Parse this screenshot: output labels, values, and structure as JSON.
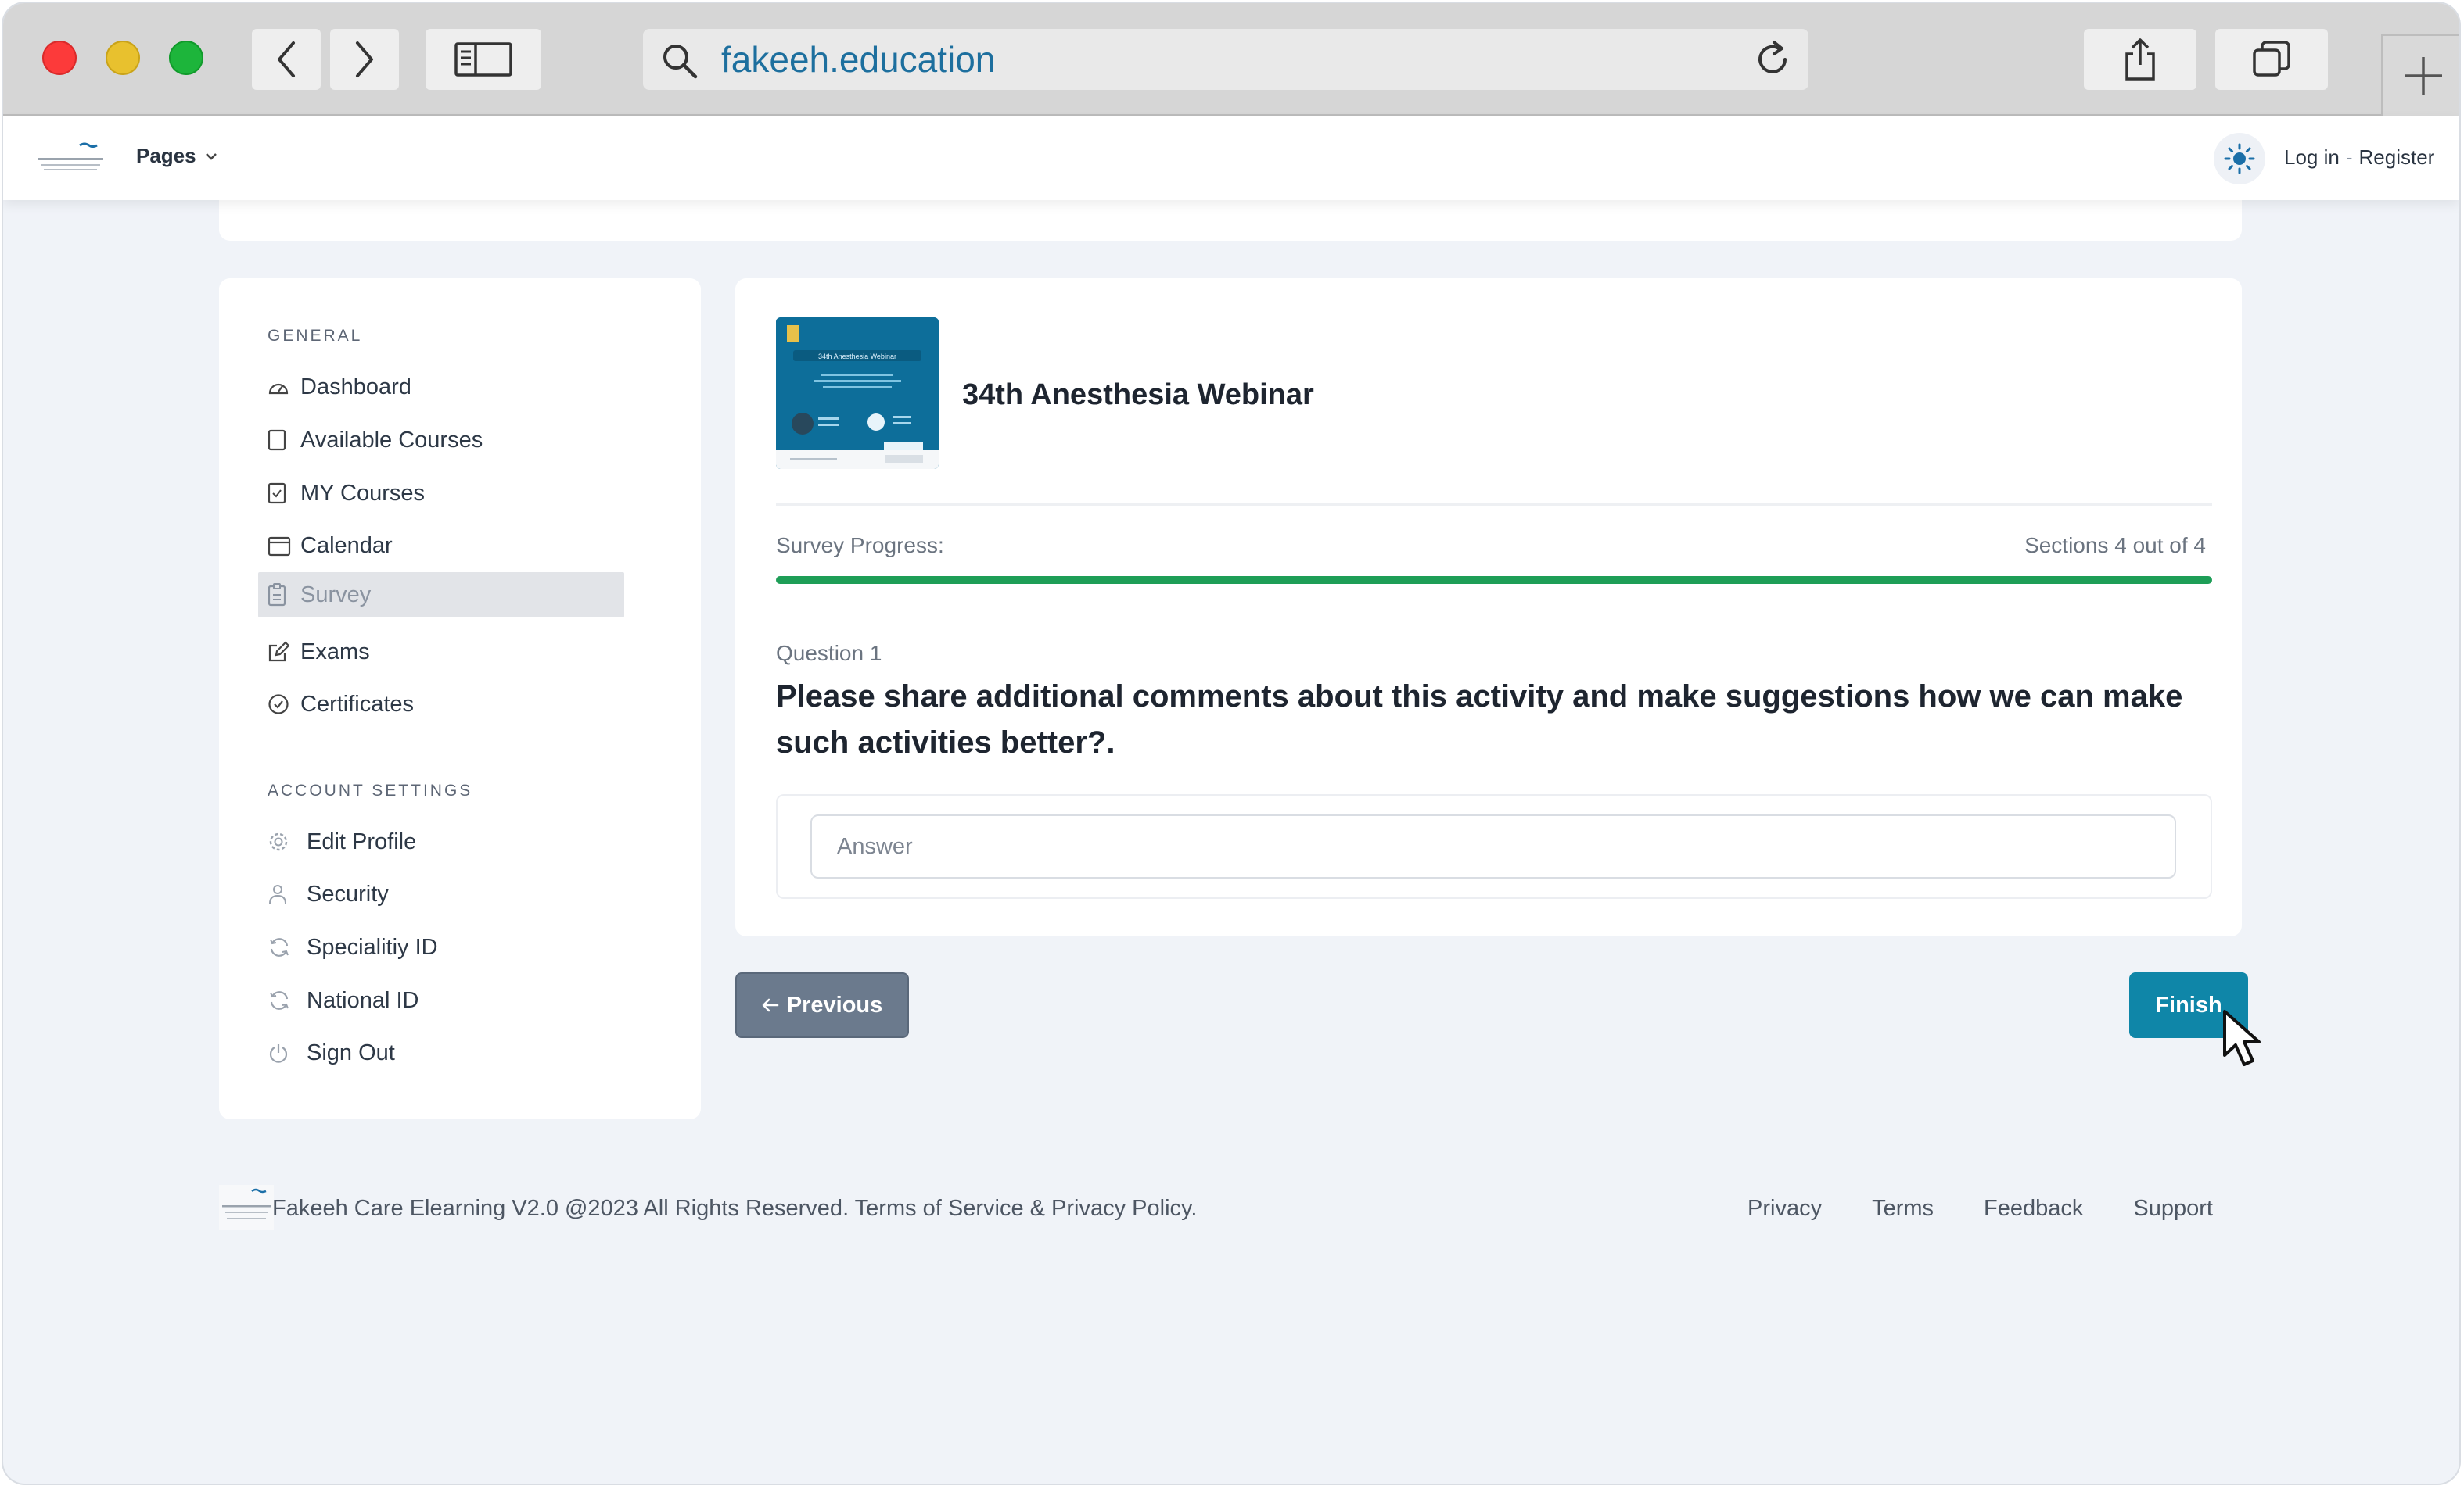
{
  "browser": {
    "url": "fakeeh.education"
  },
  "header": {
    "pages_label": "Pages",
    "login_label": "Log in",
    "separator": "-",
    "register_label": "Register"
  },
  "sidebar": {
    "general_heading": "GENERAL",
    "general_items": [
      {
        "label": "Dashboard",
        "icon": "dashboard-icon"
      },
      {
        "label": "Available Courses",
        "icon": "square-icon"
      },
      {
        "label": "MY Courses",
        "icon": "checkbox-icon"
      },
      {
        "label": "Calendar",
        "icon": "calendar-icon"
      },
      {
        "label": "Survey",
        "icon": "clipboard-icon",
        "active": true
      },
      {
        "label": "Exams",
        "icon": "edit-icon"
      },
      {
        "label": "Certificates",
        "icon": "check-circle-icon"
      }
    ],
    "account_heading": "ACCOUNT SETTINGS",
    "account_items": [
      {
        "label": "Edit Profile",
        "icon": "gear-icon"
      },
      {
        "label": "Security",
        "icon": "user-icon"
      },
      {
        "label": "Specialitiy ID",
        "icon": "refresh-icon"
      },
      {
        "label": "National ID",
        "icon": "refresh-icon"
      },
      {
        "label": "Sign Out",
        "icon": "power-icon"
      }
    ]
  },
  "course": {
    "title": "34th Anesthesia Webinar",
    "thumbnail_title": "34th Anesthesia Webinar"
  },
  "survey": {
    "progress_label": "Survey Progress:",
    "progress_count": "Sections 4 out of 4",
    "progress_fraction": 1.0,
    "question_number": "Question 1",
    "question_text": "Please share additional comments about this activity and make suggestions how we can make such activities better?.",
    "answer_placeholder": "Answer",
    "answer_value": ""
  },
  "actions": {
    "previous_label": "Previous",
    "finish_label": "Finish"
  },
  "footer": {
    "copyright": "Fakeeh Care Elearning V2.0 @2023 All Rights Reserved. Terms of Service & Privacy Policy.",
    "links": [
      "Privacy",
      "Terms",
      "Feedback",
      "Support"
    ]
  },
  "colors": {
    "accent": "#0f86a8",
    "progress": "#1e9e57",
    "previous_button": "#6b7a8d",
    "background": "#f0f3f8"
  }
}
